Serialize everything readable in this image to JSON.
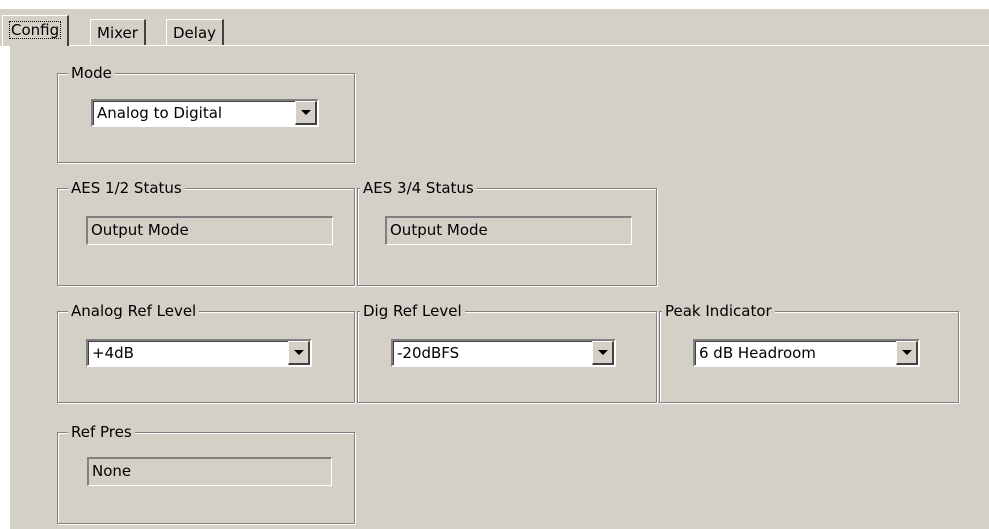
{
  "tabs": [
    {
      "label": "Config",
      "active": true
    },
    {
      "label": "Mixer",
      "active": false
    },
    {
      "label": "Delay",
      "active": false
    }
  ],
  "mode": {
    "legend": "Mode",
    "value": "Analog to Digital"
  },
  "aes12": {
    "legend": "AES 1/2 Status",
    "value": "Output Mode"
  },
  "aes34": {
    "legend": "AES 3/4 Status",
    "value": "Output Mode"
  },
  "analog_ref": {
    "legend": "Analog Ref Level",
    "value": "+4dB"
  },
  "dig_ref": {
    "legend": "Dig Ref Level",
    "value": "-20dBFS"
  },
  "peak": {
    "legend": "Peak Indicator",
    "value": "6 dB Headroom"
  },
  "ref_pres": {
    "legend": "Ref Pres",
    "value": "None"
  },
  "colors": {
    "face": "#d4d0c8",
    "highlight": "#ffffff",
    "shadow": "#808080",
    "dark_shadow": "#404040"
  },
  "icons": {
    "dropdown": "chevron-down-icon"
  }
}
